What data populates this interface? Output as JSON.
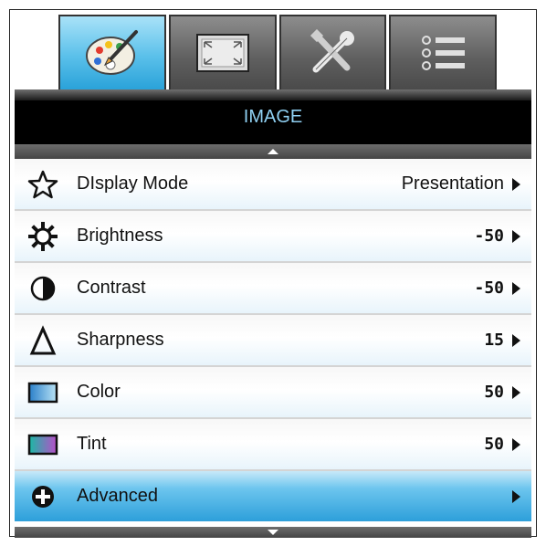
{
  "tabs": [
    {
      "icon": "palette-icon",
      "active": true
    },
    {
      "icon": "display-screen-icon",
      "active": false
    },
    {
      "icon": "tools-icon",
      "active": false
    },
    {
      "icon": "list-menu-icon",
      "active": false
    }
  ],
  "header": {
    "title": "IMAGE"
  },
  "menu": {
    "items": [
      {
        "label": "DIsplay Mode",
        "value": "Presentation",
        "icon": "star-icon"
      },
      {
        "label": "Brightness",
        "value": "-50",
        "icon": "sun-icon"
      },
      {
        "label": "Contrast",
        "value": "-50",
        "icon": "contrast-icon"
      },
      {
        "label": "Sharpness",
        "value": "15",
        "icon": "triangle-icon"
      },
      {
        "label": "Color",
        "value": "50",
        "icon": "color-swatch-icon"
      },
      {
        "label": "Tint",
        "value": "50",
        "icon": "tint-swatch-icon"
      },
      {
        "label": "Advanced",
        "value": "",
        "icon": "plus-circle-icon"
      }
    ]
  },
  "colors": {
    "accent": "#2aa2d9",
    "header_text": "#8fd0f2",
    "header_bg": "#000000"
  }
}
